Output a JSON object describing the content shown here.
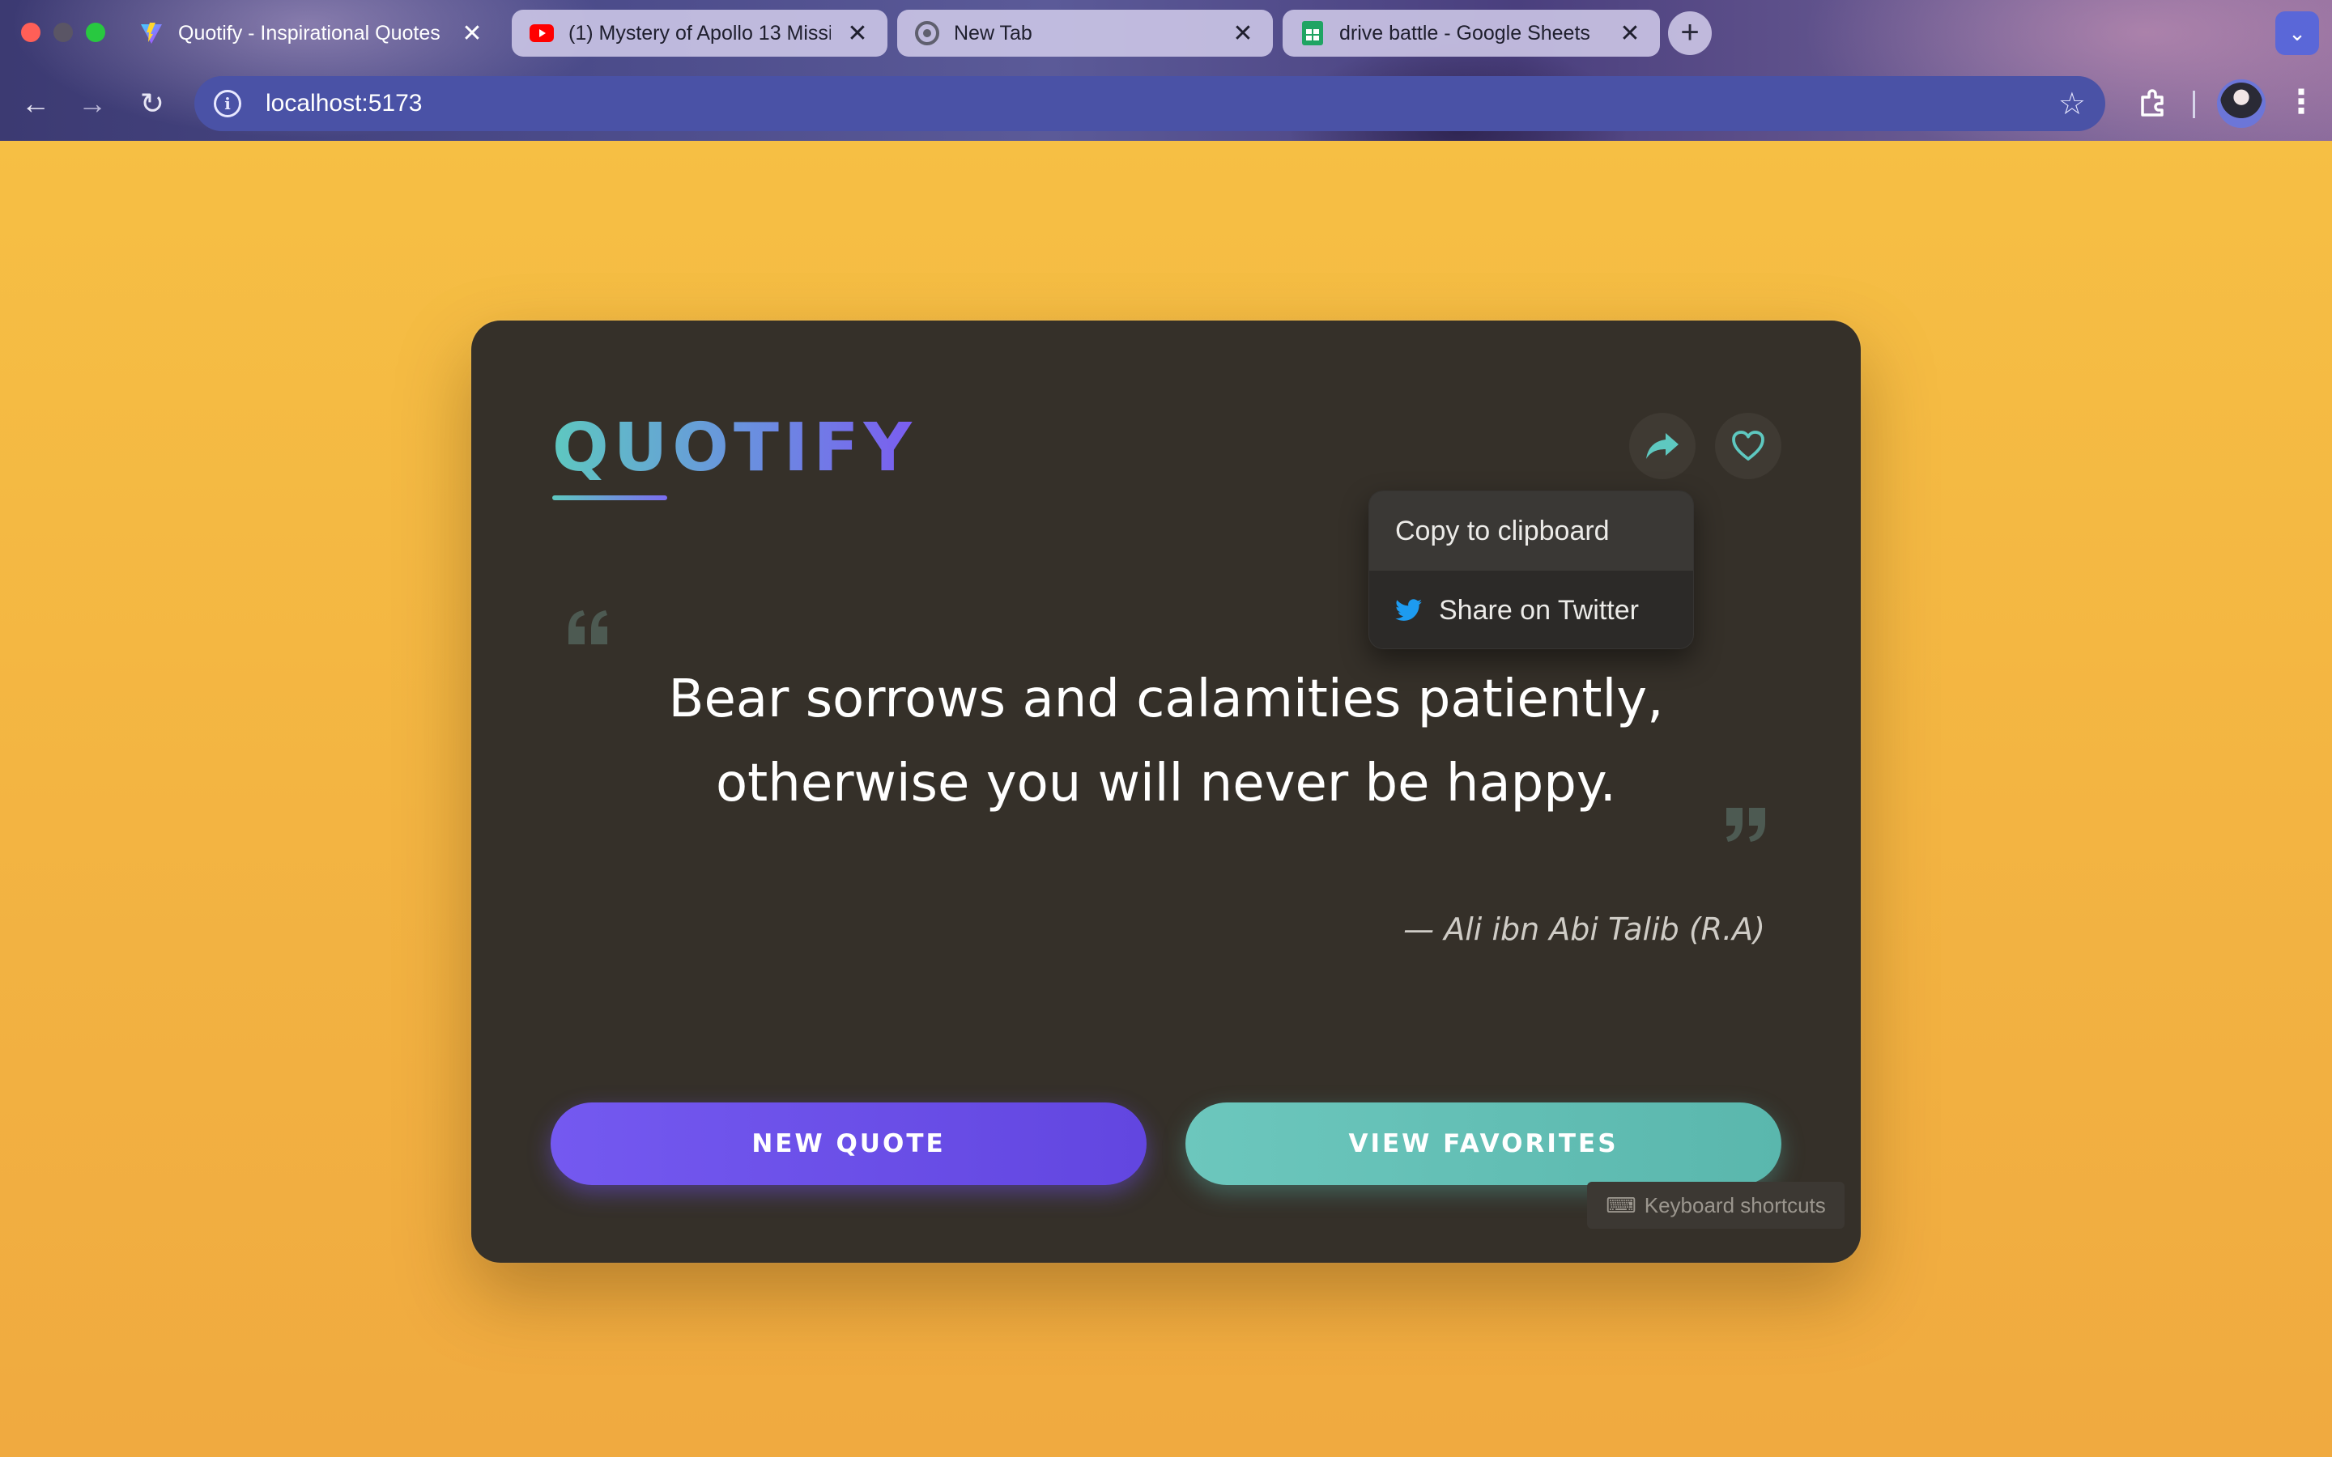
{
  "browser": {
    "tabs": [
      {
        "title": "Quotify - Inspirational Quotes",
        "icon": "vite-icon",
        "active": true
      },
      {
        "title": "(1) Mystery of Apollo 13 Missi",
        "icon": "youtube-icon",
        "active": false
      },
      {
        "title": "New Tab",
        "icon": "chrome-icon",
        "active": false
      },
      {
        "title": "drive battle - Google Sheets",
        "icon": "sheets-icon",
        "active": false
      }
    ],
    "url": "localhost:5173",
    "close_glyph": "✕",
    "new_tab_glyph": "+",
    "back_glyph": "←",
    "forward_glyph": "→",
    "reload_glyph": "↻",
    "star_glyph": "☆",
    "menu_glyph": "⋮",
    "tab_search_glyph": "⌄"
  },
  "app": {
    "logo": "QUOTIFY",
    "share_menu": {
      "copy_label": "Copy to clipboard",
      "twitter_label": "Share on Twitter"
    },
    "quote": {
      "text": "Bear sorrows and calamities patiently, otherwise you will never be happy.",
      "author": "— Ali ibn Abi Talib (R.A)"
    },
    "buttons": {
      "new_quote": "NEW QUOTE",
      "view_favorites": "VIEW FAVORITES"
    },
    "keyboard_hint": "Keyboard shortcuts",
    "keyboard_glyph": "⌨"
  },
  "colors": {
    "accent_teal": "#5ec8c0",
    "accent_purple": "#7459f0",
    "card_bg": "#353029",
    "page_bg": "#f4b443"
  }
}
